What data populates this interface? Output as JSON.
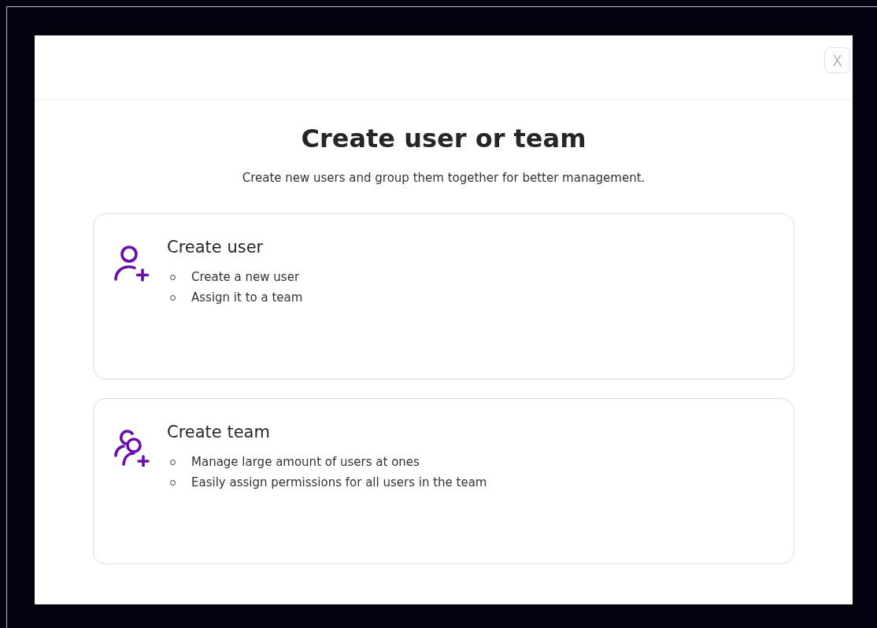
{
  "dialog": {
    "close_label": "X",
    "title": "Create user or team",
    "subtitle": "Create new users and group them together for better management.",
    "options": [
      {
        "kind": "user",
        "title": "Create user",
        "points": [
          "Create a new user",
          "Assign it to a team"
        ]
      },
      {
        "kind": "team",
        "title": "Create team",
        "points": [
          "Manage large amount of users at ones",
          "Easily assign permissions for all users in the team"
        ]
      }
    ]
  }
}
